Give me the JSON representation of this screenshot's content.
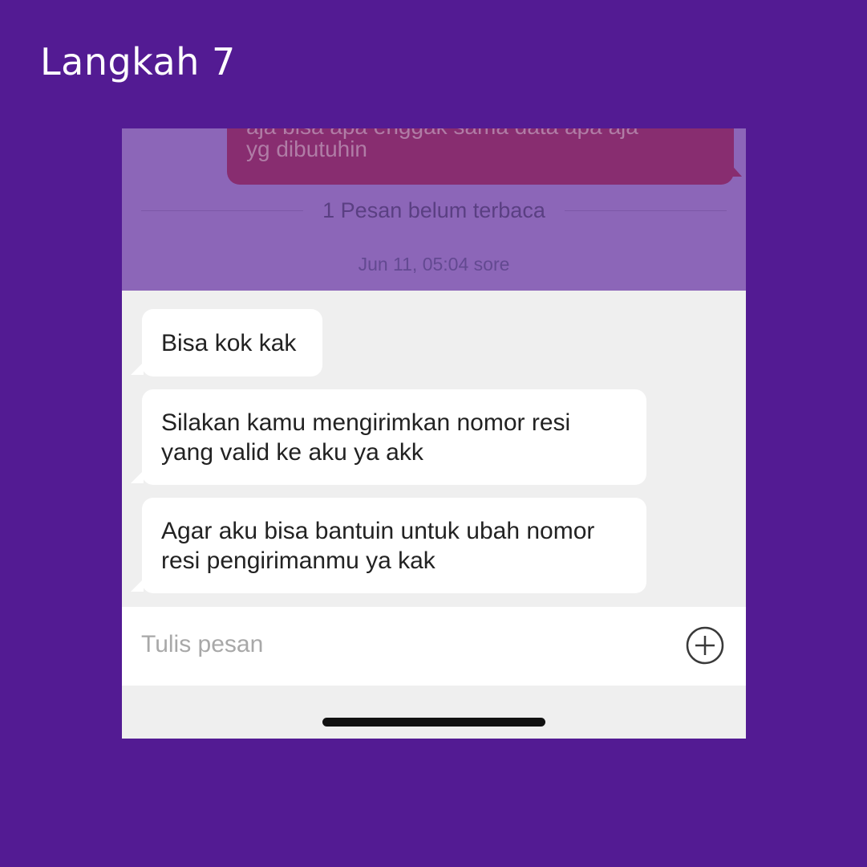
{
  "step": {
    "title": "Langkah 7"
  },
  "chat": {
    "sent_message_cut": "aja bisa apa enggak sama data apa aja",
    "sent_message_tail": "yg dibutuhin",
    "unread_divider": "1 Pesan belum terbaca",
    "timestamp": "Jun 11, 05:04 sore",
    "messages": [
      {
        "lines": [
          "Bisa kok kak"
        ]
      },
      {
        "lines": [
          "Silakan kamu mengirimkan nomor resi",
          "yang valid ke aku ya akk"
        ]
      },
      {
        "lines": [
          "Agar aku bisa bantuin untuk ubah nomor",
          "resi pengirimanmu ya kak"
        ]
      }
    ]
  },
  "composer": {
    "placeholder": "Tulis pesan",
    "add_icon": "plus-circle-icon"
  },
  "colors": {
    "background": "#531b93",
    "overlay": "#8c66b8",
    "sent_bubble": "#882d70",
    "bubble": "#ffffff",
    "chat_bg": "#efefef"
  }
}
